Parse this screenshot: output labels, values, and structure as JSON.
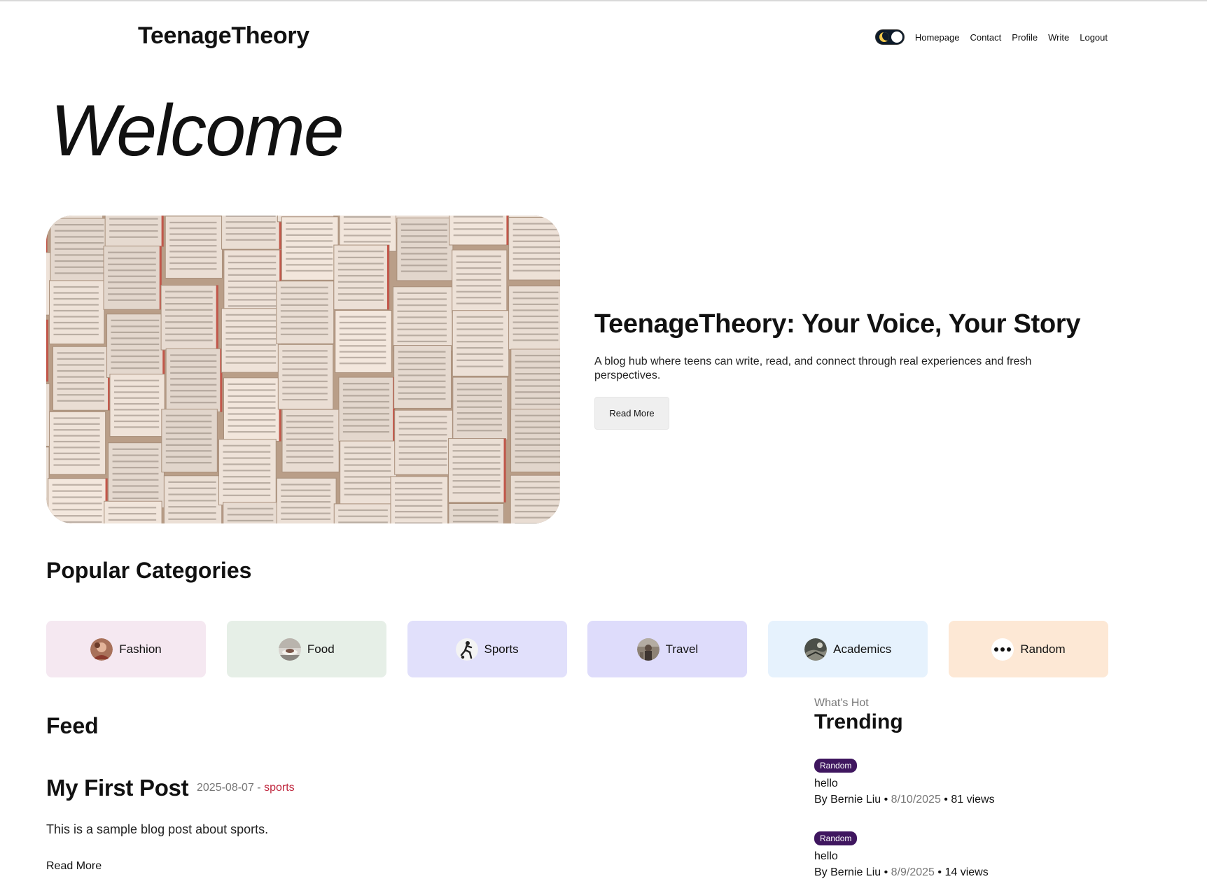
{
  "header": {
    "brand": "TeenageTheory",
    "nav": [
      "Homepage",
      "Contact",
      "Profile",
      "Write",
      "Logout"
    ]
  },
  "welcome": "Welcome",
  "hero": {
    "title": "TeenageTheory: Your Voice, Your Story",
    "description": "A blog hub where teens can write, read, and connect through real experiences and fresh perspectives.",
    "button": "Read More"
  },
  "categories": {
    "heading": "Popular Categories",
    "items": [
      {
        "label": "Fashion",
        "color": "#f5e8f1",
        "icon": "fashion-avatar-icon"
      },
      {
        "label": "Food",
        "color": "#e6efe7",
        "icon": "food-avatar-icon"
      },
      {
        "label": "Sports",
        "color": "#e1e0fb",
        "icon": "sports-avatar-icon"
      },
      {
        "label": "Travel",
        "color": "#dedcfb",
        "icon": "travel-avatar-icon"
      },
      {
        "label": "Academics",
        "color": "#e6f2fd",
        "icon": "academics-avatar-icon"
      },
      {
        "label": "Random",
        "color": "#fde8d5",
        "icon": "more-dots-icon"
      }
    ]
  },
  "feed": {
    "heading": "Feed",
    "post": {
      "title": "My First Post",
      "date": "2025-08-07 -",
      "tag": "sports",
      "body": "This is a sample blog post about sports.",
      "read_more": "Read More"
    }
  },
  "trending": {
    "kicker": "What's Hot",
    "heading": "Trending",
    "items": [
      {
        "badge": "Random",
        "title": "hello",
        "author": "By Bernie Liu",
        "date": "8/10/2025",
        "views": "81 views"
      },
      {
        "badge": "Random",
        "title": "hello",
        "author": "By Bernie Liu",
        "date": "8/9/2025",
        "views": "14 views"
      }
    ]
  },
  "colors": {
    "badge": "#3f165f",
    "tag": "#c0283f",
    "toggle": "#0d1b2a"
  }
}
